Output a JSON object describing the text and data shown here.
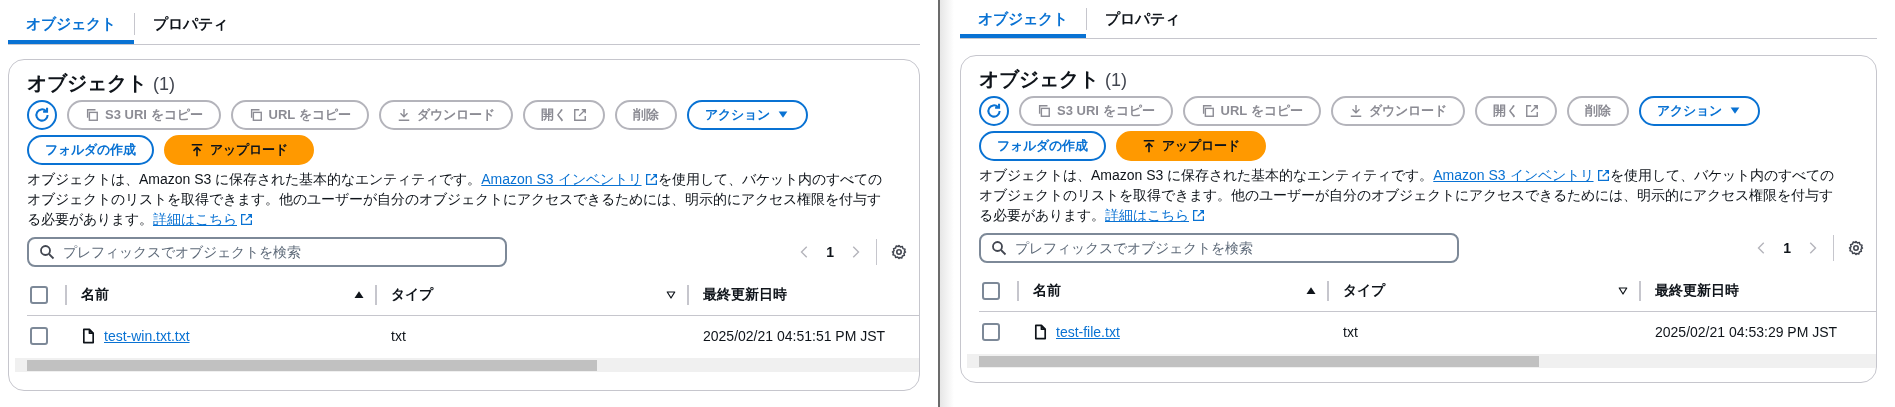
{
  "panes": [
    {
      "tabs": [
        {
          "label": "オブジェクト",
          "selected": true
        },
        {
          "label": "プロパティ",
          "selected": false
        }
      ],
      "card": {
        "title": "オブジェクト",
        "count": "(1)",
        "toolbar": [
          {
            "kind": "refresh",
            "disabled": false
          },
          {
            "kind": "copy",
            "label": "S3 URI をコピー",
            "disabled": true
          },
          {
            "kind": "copy",
            "label": "URL をコピー",
            "disabled": true
          },
          {
            "kind": "download",
            "label": "ダウンロード",
            "disabled": true
          },
          {
            "kind": "open",
            "label": "開く",
            "disabled": true
          },
          {
            "kind": "delete",
            "label": "削除",
            "disabled": true
          },
          {
            "kind": "menu",
            "label": "アクション",
            "disabled": false
          },
          {
            "kind": "create",
            "label": "フォルダの作成",
            "disabled": false
          },
          {
            "kind": "upload",
            "label": "アップロード",
            "disabled": false
          }
        ],
        "description": [
          {
            "kind": "text",
            "text": "オブジェクトは、Amazon S3 に保存された基本的なエンティティです。"
          },
          {
            "kind": "link",
            "text": "Amazon S3 インベントリ"
          },
          {
            "kind": "text",
            "text": "を使用して、バケット内のすべてのオブジェクトのリストを取得できます。他のユーザーが自分のオブジェクトにアクセスできるためには、明示的にアクセス権限を付与する必要があります。"
          },
          {
            "kind": "link",
            "text": "詳細はこちら"
          }
        ],
        "search": {
          "placeholder": "プレフィックスでオブジェクトを検索"
        },
        "pagination": {
          "page": "1"
        },
        "table": {
          "select_all": {
            "checked": false
          },
          "columns": [
            {
              "label": "名前",
              "sorted": true
            },
            {
              "label": "タイプ",
              "sorted": false
            },
            {
              "label": "最終更新日時"
            }
          ],
          "rows": [
            {
              "checked": false,
              "name": "test-win.txt.txt",
              "type": "txt",
              "modified": "2025/02/21 04:51:51 PM JST"
            }
          ]
        }
      }
    },
    {
      "tabs": [
        {
          "label": "オブジェクト",
          "selected": true
        },
        {
          "label": "プロパティ",
          "selected": false
        }
      ],
      "card": {
        "title": "オブジェクト",
        "count": "(1)",
        "toolbar": [
          {
            "kind": "refresh",
            "disabled": false
          },
          {
            "kind": "copy",
            "label": "S3 URI をコピー",
            "disabled": true
          },
          {
            "kind": "copy",
            "label": "URL をコピー",
            "disabled": true
          },
          {
            "kind": "download",
            "label": "ダウンロード",
            "disabled": true
          },
          {
            "kind": "open",
            "label": "開く",
            "disabled": true
          },
          {
            "kind": "delete",
            "label": "削除",
            "disabled": true
          },
          {
            "kind": "menu",
            "label": "アクション",
            "disabled": false
          },
          {
            "kind": "create",
            "label": "フォルダの作成",
            "disabled": false
          },
          {
            "kind": "upload",
            "label": "アップロード",
            "disabled": false
          }
        ],
        "description": [
          {
            "kind": "text",
            "text": "オブジェクトは、Amazon S3 に保存された基本的なエンティティです。"
          },
          {
            "kind": "link",
            "text": "Amazon S3 インベントリ"
          },
          {
            "kind": "text",
            "text": "を使用して、バケット内のすべてのオブジェクトのリストを取得できます。他のユーザーが自分のオブジェクトにアクセスできるためには、明示的にアクセス権限を付与する必要があります。"
          },
          {
            "kind": "link",
            "text": "詳細はこちら"
          }
        ],
        "search": {
          "placeholder": "プレフィックスでオブジェクトを検索"
        },
        "pagination": {
          "page": "1"
        },
        "table": {
          "select_all": {
            "checked": false
          },
          "columns": [
            {
              "label": "名前",
              "sorted": true
            },
            {
              "label": "タイプ",
              "sorted": false
            },
            {
              "label": "最終更新日時"
            }
          ],
          "rows": [
            {
              "checked": false,
              "name": "test-file.txt",
              "type": "txt",
              "modified": "2025/02/21 04:53:29 PM JST"
            }
          ]
        }
      }
    }
  ]
}
